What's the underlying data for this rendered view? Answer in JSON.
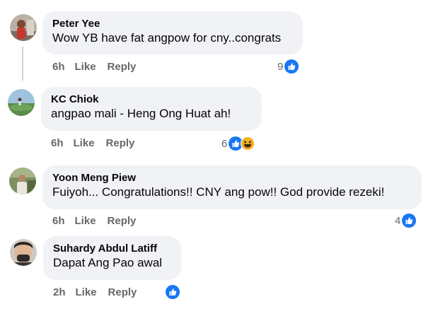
{
  "comments": [
    {
      "author": "Peter Yee",
      "text": "Wow YB have fat angpow for cny..congrats",
      "time": "6h",
      "like_label": "Like",
      "reply_label": "Reply",
      "reaction_count": "9",
      "reactions": [
        "like-icon"
      ]
    },
    {
      "author": "KC Chiok",
      "text": "angpao mali - Heng Ong Huat ah!",
      "time": "6h",
      "like_label": "Like",
      "reply_label": "Reply",
      "reaction_count": "6",
      "reactions": [
        "like-icon",
        "haha-icon"
      ]
    },
    {
      "author": "Yoon Meng Piew",
      "text": "Fuiyoh... Congratulations!! CNY ang pow!! God provide rezeki!",
      "time": "6h",
      "like_label": "Like",
      "reply_label": "Reply",
      "reaction_count": "4",
      "reactions": [
        "like-icon"
      ]
    },
    {
      "author": "Suhardy Abdul Latiff",
      "text": "Dapat Ang Pao awal",
      "time": "2h",
      "like_label": "Like",
      "reply_label": "Reply",
      "reaction_count": "",
      "reactions": [
        "like-icon"
      ]
    }
  ],
  "colors": {
    "bubble": "#f0f2f5",
    "meta": "#65676b",
    "like_blue": "#1877f2",
    "haha_yellow": "#f7b125"
  }
}
